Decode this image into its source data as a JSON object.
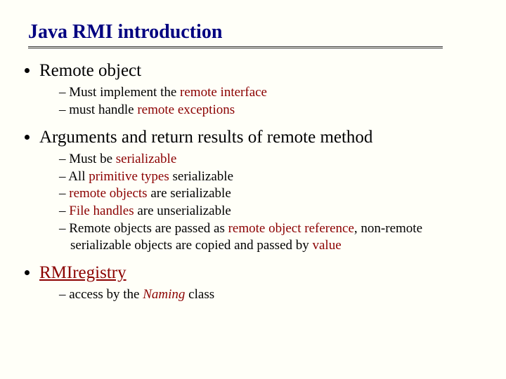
{
  "title": "Java RMI introduction",
  "b1": {
    "label": "Remote object",
    "s1_a": "Must implement the ",
    "s1_b": "remote interface",
    "s2_a": "must handle ",
    "s2_b": "remote exceptions"
  },
  "b2": {
    "label": "Arguments and return results of remote method",
    "s1_a": "Must be ",
    "s1_b": "serializable",
    "s2_a": "All ",
    "s2_b": "primitive types",
    "s2_c": " serializable",
    "s3_a": "remote objects",
    "s3_b": " are serializable",
    "s4_a": "File handles",
    "s4_b": " are unserializable",
    "s5_a": "Remote objects are passed as ",
    "s5_b": "remote object reference",
    "s5_c": ", non-remote serializable objects are copied and passed by ",
    "s5_d": "value"
  },
  "b3": {
    "label": "RMIregistry",
    "s1_a": "access by the ",
    "s1_b": "Naming",
    "s1_c": " class"
  }
}
